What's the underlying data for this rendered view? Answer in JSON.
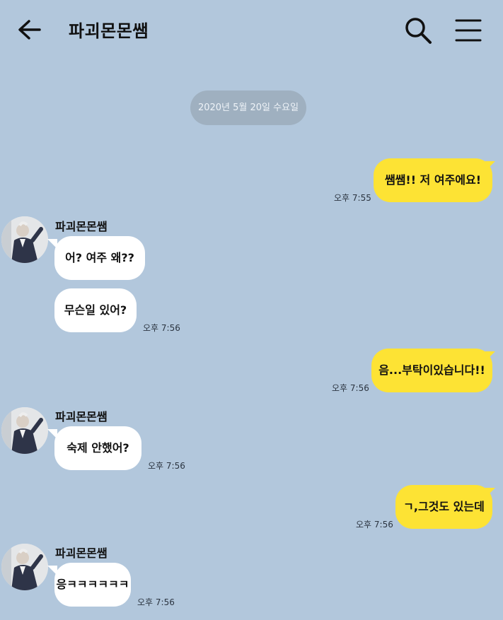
{
  "header": {
    "title": "파괴몬몬쌤",
    "back_icon": "arrow-left-icon",
    "search_icon": "search-icon",
    "menu_icon": "hamburger-menu-icon"
  },
  "date_divider": "2020년 5월 20일 수요일",
  "colors": {
    "background": "#b2c7dc",
    "my_bubble": "#fde334",
    "their_bubble": "#ffffff",
    "date_pill": "#9fb0c0"
  },
  "messages": [
    {
      "from": "me",
      "text": "쌤쌤!! 저 여주에요!",
      "time": "오후 7:55"
    },
    {
      "from": "them",
      "sender": "파괴몬몬쌤",
      "text": "어? 여주 왜??"
    },
    {
      "from": "them",
      "text": "무슨일 있어?",
      "time": "오후 7:56"
    },
    {
      "from": "me",
      "text": "음...부탁이있습니다!!",
      "time": "오후 7:56"
    },
    {
      "from": "them",
      "sender": "파괴몬몬쌤",
      "text": "숙제 안했어?",
      "time": "오후 7:56"
    },
    {
      "from": "me",
      "text": "ㄱ,그것도 있는데",
      "time": "오후 7:56"
    },
    {
      "from": "them",
      "sender": "파괴몬몬쌤",
      "text": "응ㅋㅋㅋㅋㅋㅋ",
      "time": "오후 7:56"
    }
  ]
}
